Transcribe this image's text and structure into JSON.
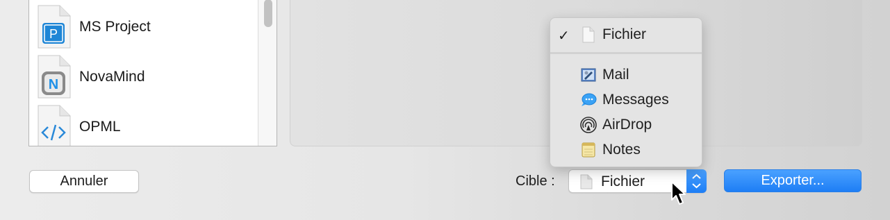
{
  "format_list": {
    "items": [
      {
        "label": "MS Project",
        "icon": "ms-project-file-icon"
      },
      {
        "label": "NovaMind",
        "icon": "novamind-file-icon"
      },
      {
        "label": "OPML",
        "icon": "opml-file-icon"
      }
    ]
  },
  "menu": {
    "items": [
      {
        "label": "Fichier",
        "icon": "document-icon",
        "checked": true
      },
      {
        "label": "Mail",
        "icon": "mail-icon"
      },
      {
        "label": "Messages",
        "icon": "messages-icon"
      },
      {
        "label": "AirDrop",
        "icon": "airdrop-icon"
      },
      {
        "label": "Notes",
        "icon": "notes-icon"
      }
    ],
    "check_glyph": "✓"
  },
  "footer": {
    "cancel_label": "Annuler",
    "target_label": "Cible :",
    "target_value": "Fichier",
    "export_label": "Exporter..."
  },
  "colors": {
    "accent": "#1e7ef5",
    "ms_project": "#1f86d6",
    "novamind": "#1e90e8",
    "opml": "#2a89d8"
  }
}
